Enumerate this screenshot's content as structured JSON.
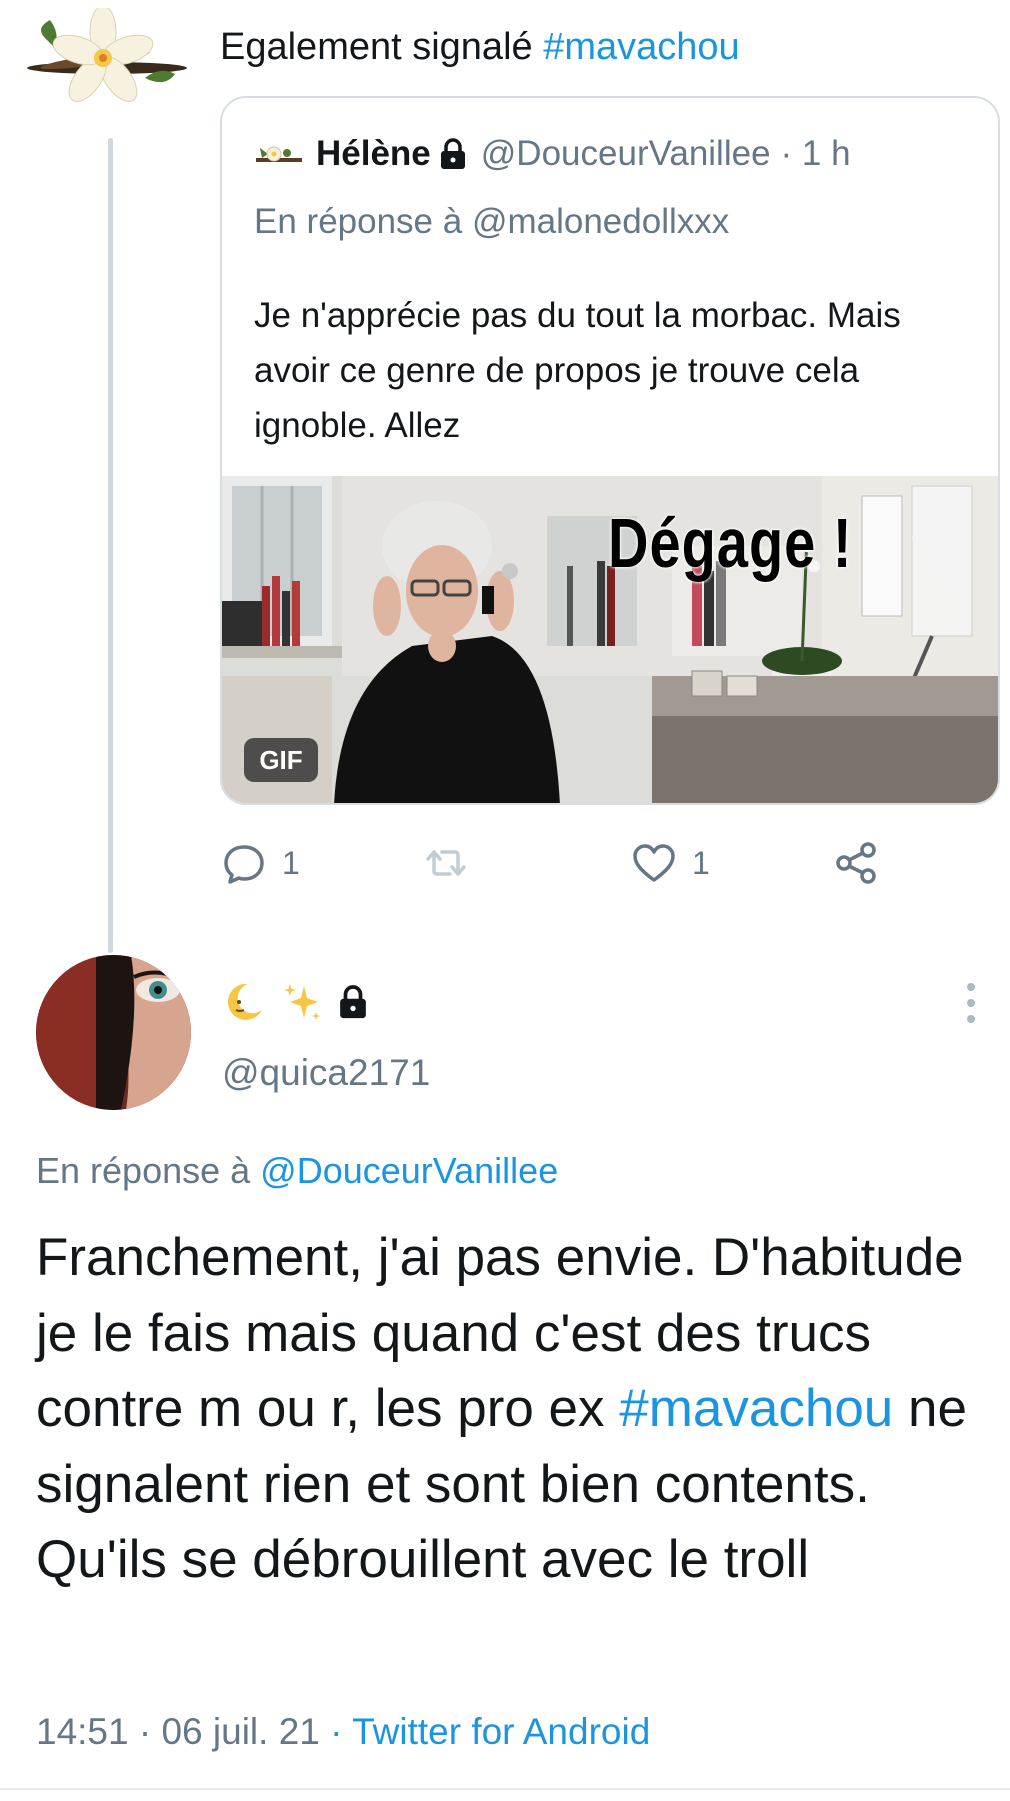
{
  "retweet_context": {
    "text": "Egalement signalé",
    "hashtag": "#mavachou"
  },
  "quoted_tweet": {
    "display_name": "Hélène",
    "handle": "@DouceurVanillee",
    "time": "· 1 h",
    "reply_prefix": "En réponse à",
    "reply_to": "@malonedollxxx",
    "body": "Je n'apprécie pas du tout la morbac. Mais avoir ce genre de propos je trouve cela ignoble. Allez",
    "gif_badge": "GIF",
    "gif_caption": "Dégage !",
    "actions": {
      "reply_count": "1",
      "like_count": "1"
    }
  },
  "main_tweet": {
    "handle": "@quica2171",
    "reply_prefix": "En réponse à",
    "reply_to": "@DouceurVanillee",
    "body_part1": "Franchement, j'ai pas envie. D'habitude je le fais mais quand c'est des trucs contre m ou r, les pro ex",
    "body_hashtag": "#mavachou",
    "body_part2": " ne signalent rien et sont bien contents. Qu'ils se débrouillent avec le troll",
    "time": "14:51",
    "date": "· 06 juil. 21",
    "source": "· Twitter for Android"
  },
  "colors": {
    "link": "#1b95e0",
    "secondary_text": "#657786",
    "border": "#d8dde1"
  }
}
